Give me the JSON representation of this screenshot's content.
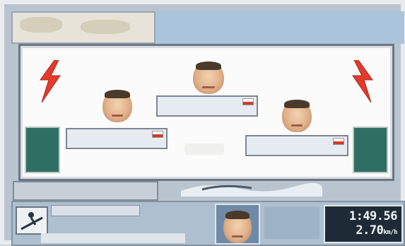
{
  "hud": {
    "time": "1:49.56",
    "speed": "2.70",
    "speed_unit": "km/h"
  },
  "podium": {
    "first": {
      "name": "",
      "team": ""
    },
    "second": {
      "name": "",
      "team": ""
    },
    "third": {
      "name": "",
      "team": ""
    }
  },
  "colors": {
    "accent_red": "#e23b2c",
    "pillar_green": "#2f6f63",
    "timer_bg": "#1e2b36"
  }
}
